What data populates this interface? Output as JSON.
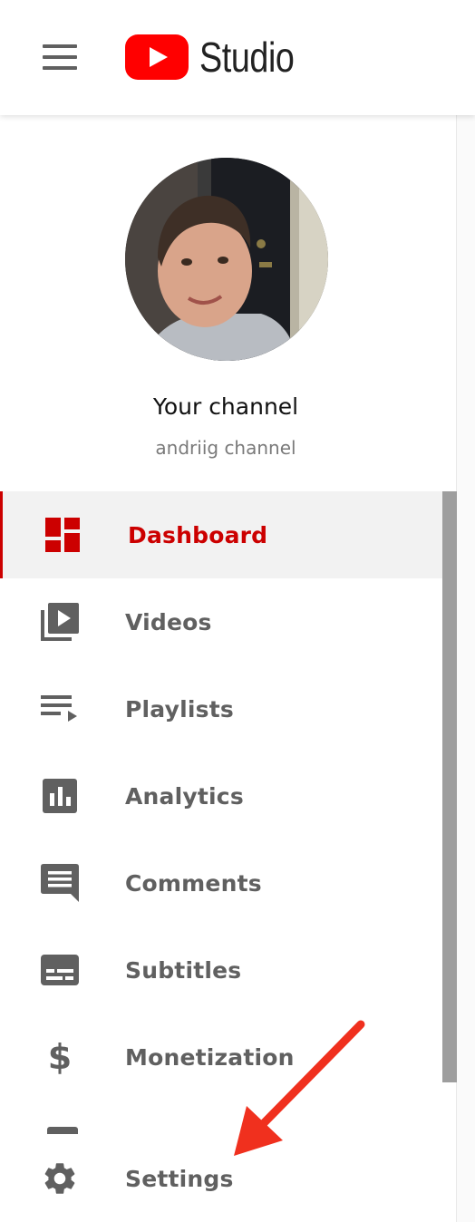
{
  "header": {
    "logo_text": "Studio",
    "colors": {
      "youtube_red": "#ff0000",
      "menu_icon": "#606060"
    }
  },
  "channel": {
    "title": "Your channel",
    "subtitle": "andriig channel"
  },
  "nav": {
    "active_color": "#cc0000",
    "items": [
      {
        "label": "Dashboard",
        "icon": "dashboard-icon",
        "active": true
      },
      {
        "label": "Videos",
        "icon": "video-library-icon",
        "active": false
      },
      {
        "label": "Playlists",
        "icon": "playlist-icon",
        "active": false
      },
      {
        "label": "Analytics",
        "icon": "analytics-icon",
        "active": false
      },
      {
        "label": "Comments",
        "icon": "comment-icon",
        "active": false
      },
      {
        "label": "Subtitles",
        "icon": "subtitles-icon",
        "active": false
      },
      {
        "label": "Monetization",
        "icon": "dollar-icon",
        "active": false
      }
    ],
    "settings": {
      "label": "Settings",
      "icon": "gear-icon"
    }
  },
  "annotation": {
    "arrow_color": "#f0301e",
    "points_to": "settings"
  }
}
